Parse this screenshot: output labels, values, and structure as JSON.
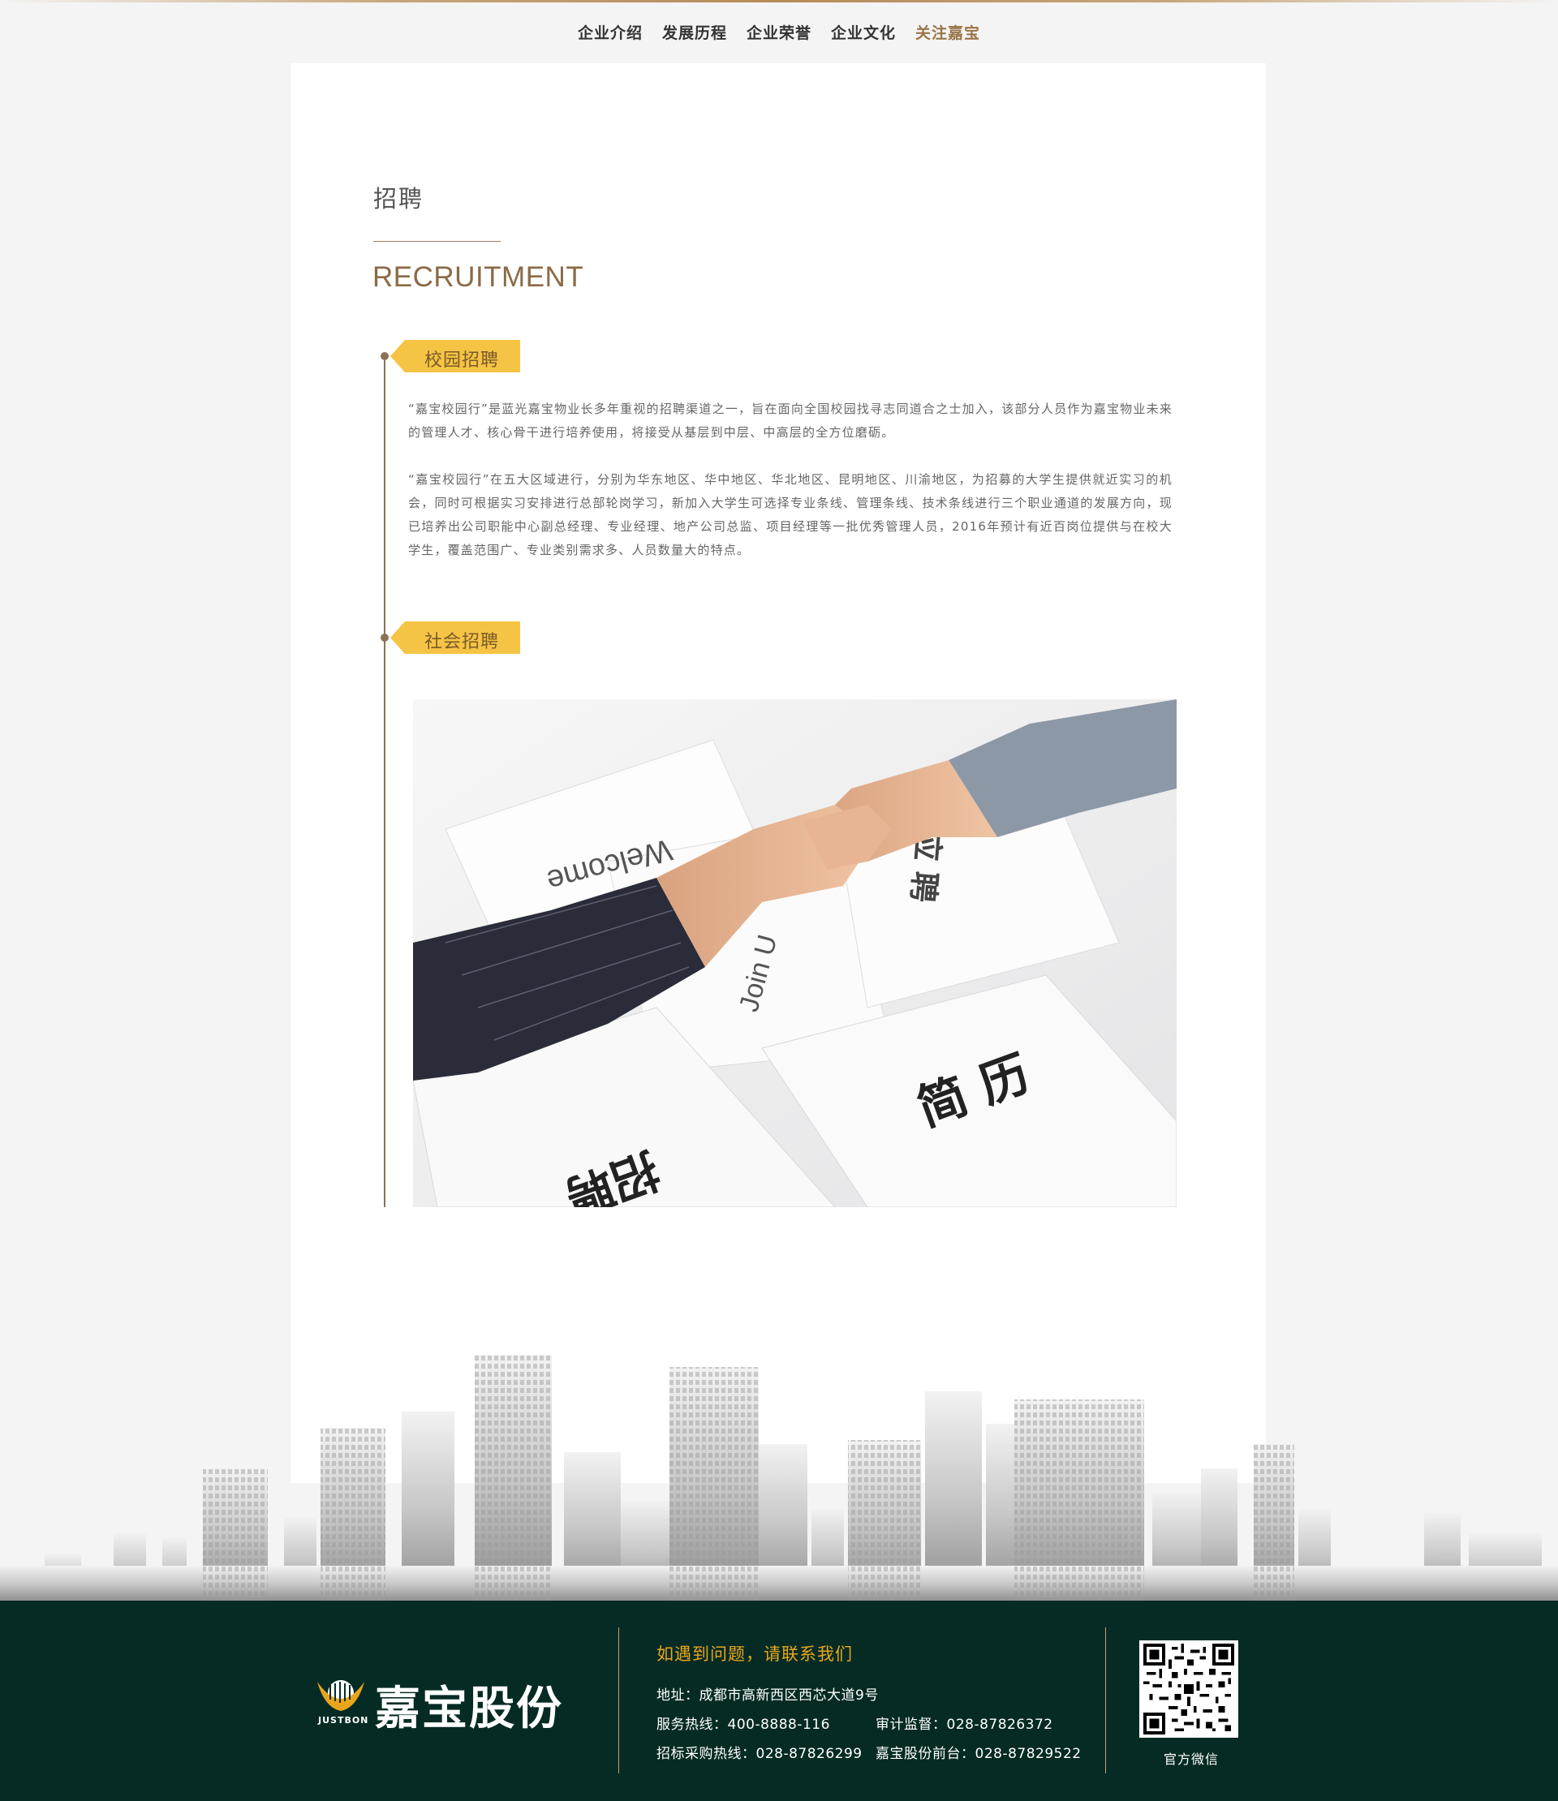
{
  "nav": {
    "items": [
      {
        "label": "企业介绍"
      },
      {
        "label": "发展历程"
      },
      {
        "label": "企业荣誉"
      },
      {
        "label": "企业文化"
      },
      {
        "label": "关注嘉宝"
      }
    ],
    "active_index": 4
  },
  "section": {
    "title_cn": "招聘",
    "title_en": "RECRUITMENT"
  },
  "campus": {
    "tag": "校园招聘",
    "para1": "“嘉宝校园行”是蓝光嘉宝物业长多年重视的招聘渠道之一，旨在面向全国校园找寻志同道合之士加入，该部分人员作为嘉宝物业未来的管理人才、核心骨干进行培养使用，将接受从基层到中层、中高层的全方位磨砺。",
    "para2": "“嘉宝校园行”在五大区域进行，分别为华东地区、华中地区、华北地区、昆明地区、川渝地区，为招募的大学生提供就近实习的机会，同时可根据实习安排进行总部轮岗学习，新加入大学生可选择专业条线、管理条线、技术条线进行三个职业通道的发展方向，现已培养出公司职能中心副总经理、专业经理、地产公司总监、项目经理等一批优秀管理人员，2016年预计有近百岗位提供与在校大学生，覆盖范围广、专业类别需求多、人员数量大的特点。"
  },
  "social": {
    "tag": "社会招聘",
    "photo_texts": {
      "welcome": "Welcome",
      "join": "Join U",
      "resume": "简 历",
      "recruit": "招聘",
      "offer": "应 聘"
    }
  },
  "footer": {
    "logo_text": "嘉宝股份",
    "logo_sub": "JUSTBON",
    "contact_title": "如遇到问题，请联系我们",
    "address": "地址：成都市高新西区西芯大道9号",
    "service_hotline": "服务热线：400-8888-116",
    "audit": "审计监督：028-87826372",
    "bidding_hotline": "招标采购热线：028-87826299",
    "front_desk": "嘉宝股份前台：028-87829522",
    "qr_label": "官方微信"
  },
  "colors": {
    "accent": "#9a7448",
    "tag_bg": "#f5c444",
    "footer_bg": "#062b25",
    "contact_title": "#e9a51c"
  }
}
